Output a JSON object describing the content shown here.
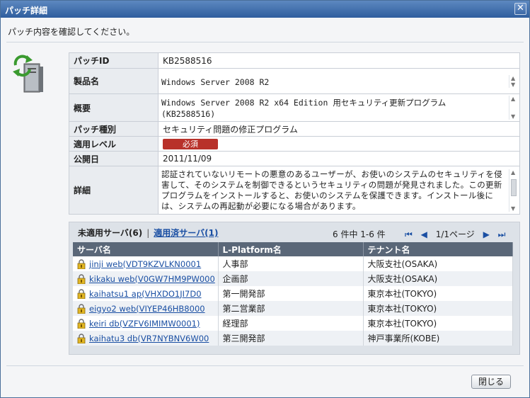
{
  "window": {
    "title": "パッチ詳細"
  },
  "message": "パッチ内容を確認してください。",
  "details": {
    "patch_id_label": "パッチID",
    "patch_id": "KB2588516",
    "product_label": "製品名",
    "product": "Windows Server 2008 R2",
    "summary_label": "概要",
    "summary": "Windows Server 2008 R2 x64 Edition 用セキュリティ更新プログラム (KB2588516)",
    "type_label": "パッチ種別",
    "type": "セキュリティ問題の修正プログラム",
    "level_label": "適用レベル",
    "level": "必須",
    "date_label": "公開日",
    "date": "2011/11/09",
    "detail_label": "詳細",
    "detail": "認証されていないリモートの悪意のあるユーザーが、お使いのシステムのセキュリティを侵害して、そのシステムを制御できるというセキュリティの問題が発見されました。この更新プログラムをインストールすると、お使いのシステムを保護できます。インストール後には、システムの再起動が必要になる場合があります。"
  },
  "tabs": {
    "unapplied": "未適用サーバ(6)",
    "separator": "|",
    "applied": "適用済サーバ(1)"
  },
  "pager": {
    "count": "6 件中 1-6 件",
    "page": "1/1ページ"
  },
  "columns": [
    "サーバ名",
    "L-Platform名",
    "テナント名"
  ],
  "servers": [
    {
      "name": "jinji web(VDT9KZVLKN0001",
      "platform": "人事部",
      "tenant": "大阪支社(OSAKA)"
    },
    {
      "name": "kikaku web(V0GW7HM9PW000",
      "platform": "企画部",
      "tenant": "大阪支社(OSAKA)"
    },
    {
      "name": "kaihatsu1 ap(VHXDO1JI7D0",
      "platform": "第一開発部",
      "tenant": "東京本社(TOKYO)"
    },
    {
      "name": "eigyo2 web(VIYEP46HB8000",
      "platform": "第二営業部",
      "tenant": "東京本社(TOKYO)"
    },
    {
      "name": "keiri db(VZFV6IMIMW0001)",
      "platform": "経理部",
      "tenant": "東京本社(TOKYO)"
    },
    {
      "name": "kaihatu3 db(VR7NYBNV6W00",
      "platform": "第三開発部",
      "tenant": "神戸事業所(KOBE)"
    }
  ],
  "buttons": {
    "close": "閉じる"
  },
  "colors": {
    "required_badge": "#b8312a",
    "titlebar": "#2f5e9e",
    "header_row": "#5a6778"
  },
  "icons": {
    "close": "close-icon",
    "server": "server-update-icon",
    "lock": "lock-warning-icon"
  }
}
